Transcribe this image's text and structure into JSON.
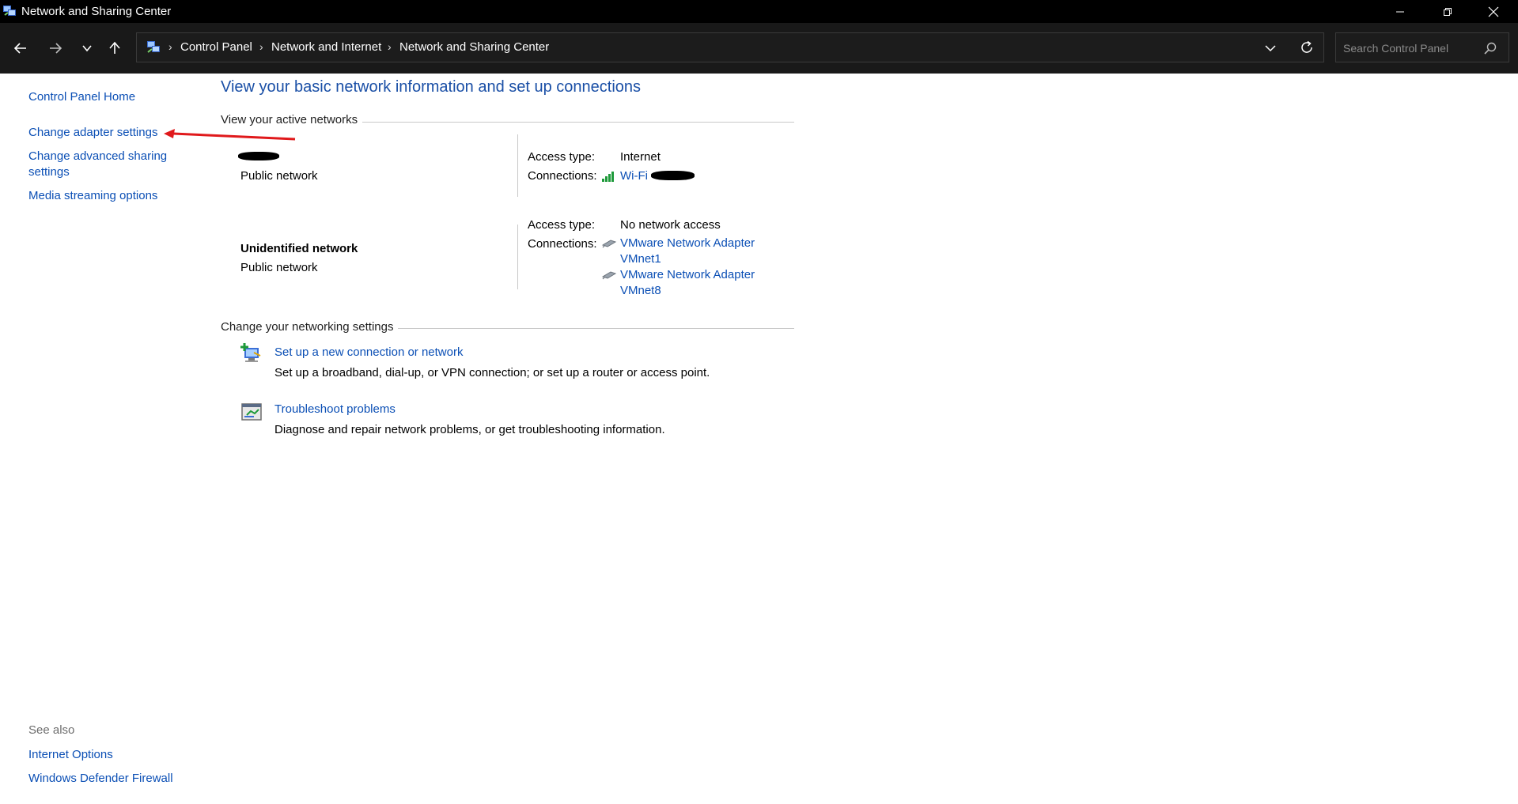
{
  "window": {
    "title": "Network and Sharing Center"
  },
  "address": {
    "crumbs": [
      "Control Panel",
      "Network and Internet",
      "Network and Sharing Center"
    ]
  },
  "search": {
    "placeholder": "Search Control Panel"
  },
  "sidebar": {
    "items": [
      {
        "label": "Control Panel Home"
      },
      {
        "label": "Change adapter settings"
      },
      {
        "label_line1": "Change advanced sharing",
        "label_line2": "settings"
      },
      {
        "label": "Media streaming options"
      }
    ],
    "see_also": {
      "heading": "See also",
      "links": [
        "Internet Options",
        "Windows Defender Firewall"
      ]
    }
  },
  "main": {
    "title": "View your basic network information and set up connections",
    "active_networks_heading": "View your active networks",
    "networks": [
      {
        "name": "",
        "category": "Public network",
        "access_type_label": "Access type:",
        "access_type": "Internet",
        "connections_label": "Connections:",
        "connections": [
          "Wi-Fi"
        ]
      },
      {
        "name": "Unidentified network",
        "category": "Public network",
        "access_type_label": "Access type:",
        "access_type": "No network access",
        "connections_label": "Connections:",
        "connections": [
          {
            "line1": "VMware Network Adapter",
            "line2": "VMnet1"
          },
          {
            "line1": "VMware Network Adapter",
            "line2": "VMnet8"
          }
        ]
      }
    ],
    "settings_heading": "Change your networking settings",
    "tasks": [
      {
        "link": "Set up a new connection or network",
        "description": "Set up a broadband, dial-up, or VPN connection; or set up a router or access point.",
        "icon": "new-connection-icon"
      },
      {
        "link": "Troubleshoot problems",
        "description": "Diagnose and repair network problems, or get troubleshooting information.",
        "icon": "troubleshoot-icon"
      }
    ]
  },
  "colors": {
    "link": "#0b4fb5",
    "title": "#1a4fa6",
    "annotation_arrow": "#e0191b",
    "chrome_bg": "#191919"
  }
}
